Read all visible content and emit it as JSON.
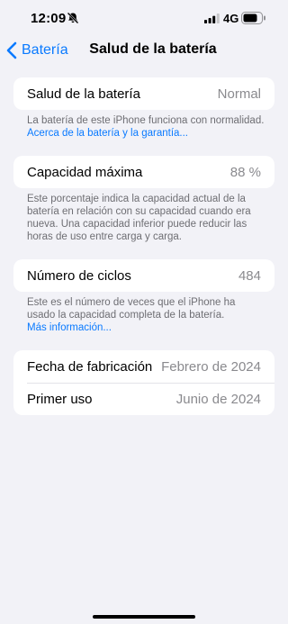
{
  "status_bar": {
    "time": "12:09",
    "network": "4G",
    "icons": [
      "bell-slash-icon",
      "cellular-signal-icon",
      "battery-icon"
    ]
  },
  "nav": {
    "back_label": "Batería",
    "title": "Salud de la batería"
  },
  "health_row": {
    "label": "Salud de la batería",
    "value": "Normal"
  },
  "health_note": {
    "text": "La batería de este iPhone funciona con normalidad.",
    "link": "Acerca de la batería y la garantía..."
  },
  "capacity_row": {
    "label": "Capacidad máxima",
    "value": "88 %"
  },
  "capacity_note": {
    "text": "Este porcentaje indica la capacidad actual de la batería en relación con su capacidad cuando era nueva. Una capacidad inferior puede reducir las horas de uso entre carga y carga."
  },
  "cycles_row": {
    "label": "Número de ciclos",
    "value": "484"
  },
  "cycles_note": {
    "text": "Este es el número de veces que el iPhone ha usado la capacidad completa de la batería.",
    "link": "Más información..."
  },
  "dates": {
    "manufacture_label": "Fecha de fabricación",
    "manufacture_value": "Febrero de 2024",
    "first_use_label": "Primer uso",
    "first_use_value": "Junio de 2024"
  },
  "colors": {
    "background": "#f2f2f7",
    "accent": "#0a7aff",
    "secondary_text": "#8a8a8e"
  }
}
